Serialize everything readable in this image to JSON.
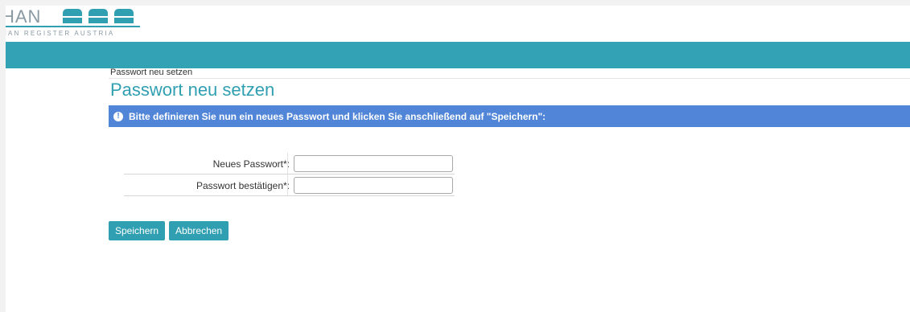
{
  "header": {
    "logo_text": "HAN",
    "logo_subtitle": "HAN Register Austria",
    "colors": {
      "teal": "#33a2b4",
      "info_blue": "#5085d8",
      "logo_grey": "#8a9aa2"
    }
  },
  "breadcrumb": "Passwort neu setzen",
  "page_title": "Passwort neu setzen",
  "info": {
    "icon": "info-icon",
    "message": "Bitte definieren Sie nun ein neues Passwort und klicken Sie anschließend auf \"Speichern\":"
  },
  "form": {
    "new_password_label": "Neues Passwort*:",
    "new_password_value": "",
    "confirm_password_label": "Passwort bestätigen*:",
    "confirm_password_value": ""
  },
  "actions": {
    "save_label": "Speichern",
    "cancel_label": "Abbrechen"
  }
}
